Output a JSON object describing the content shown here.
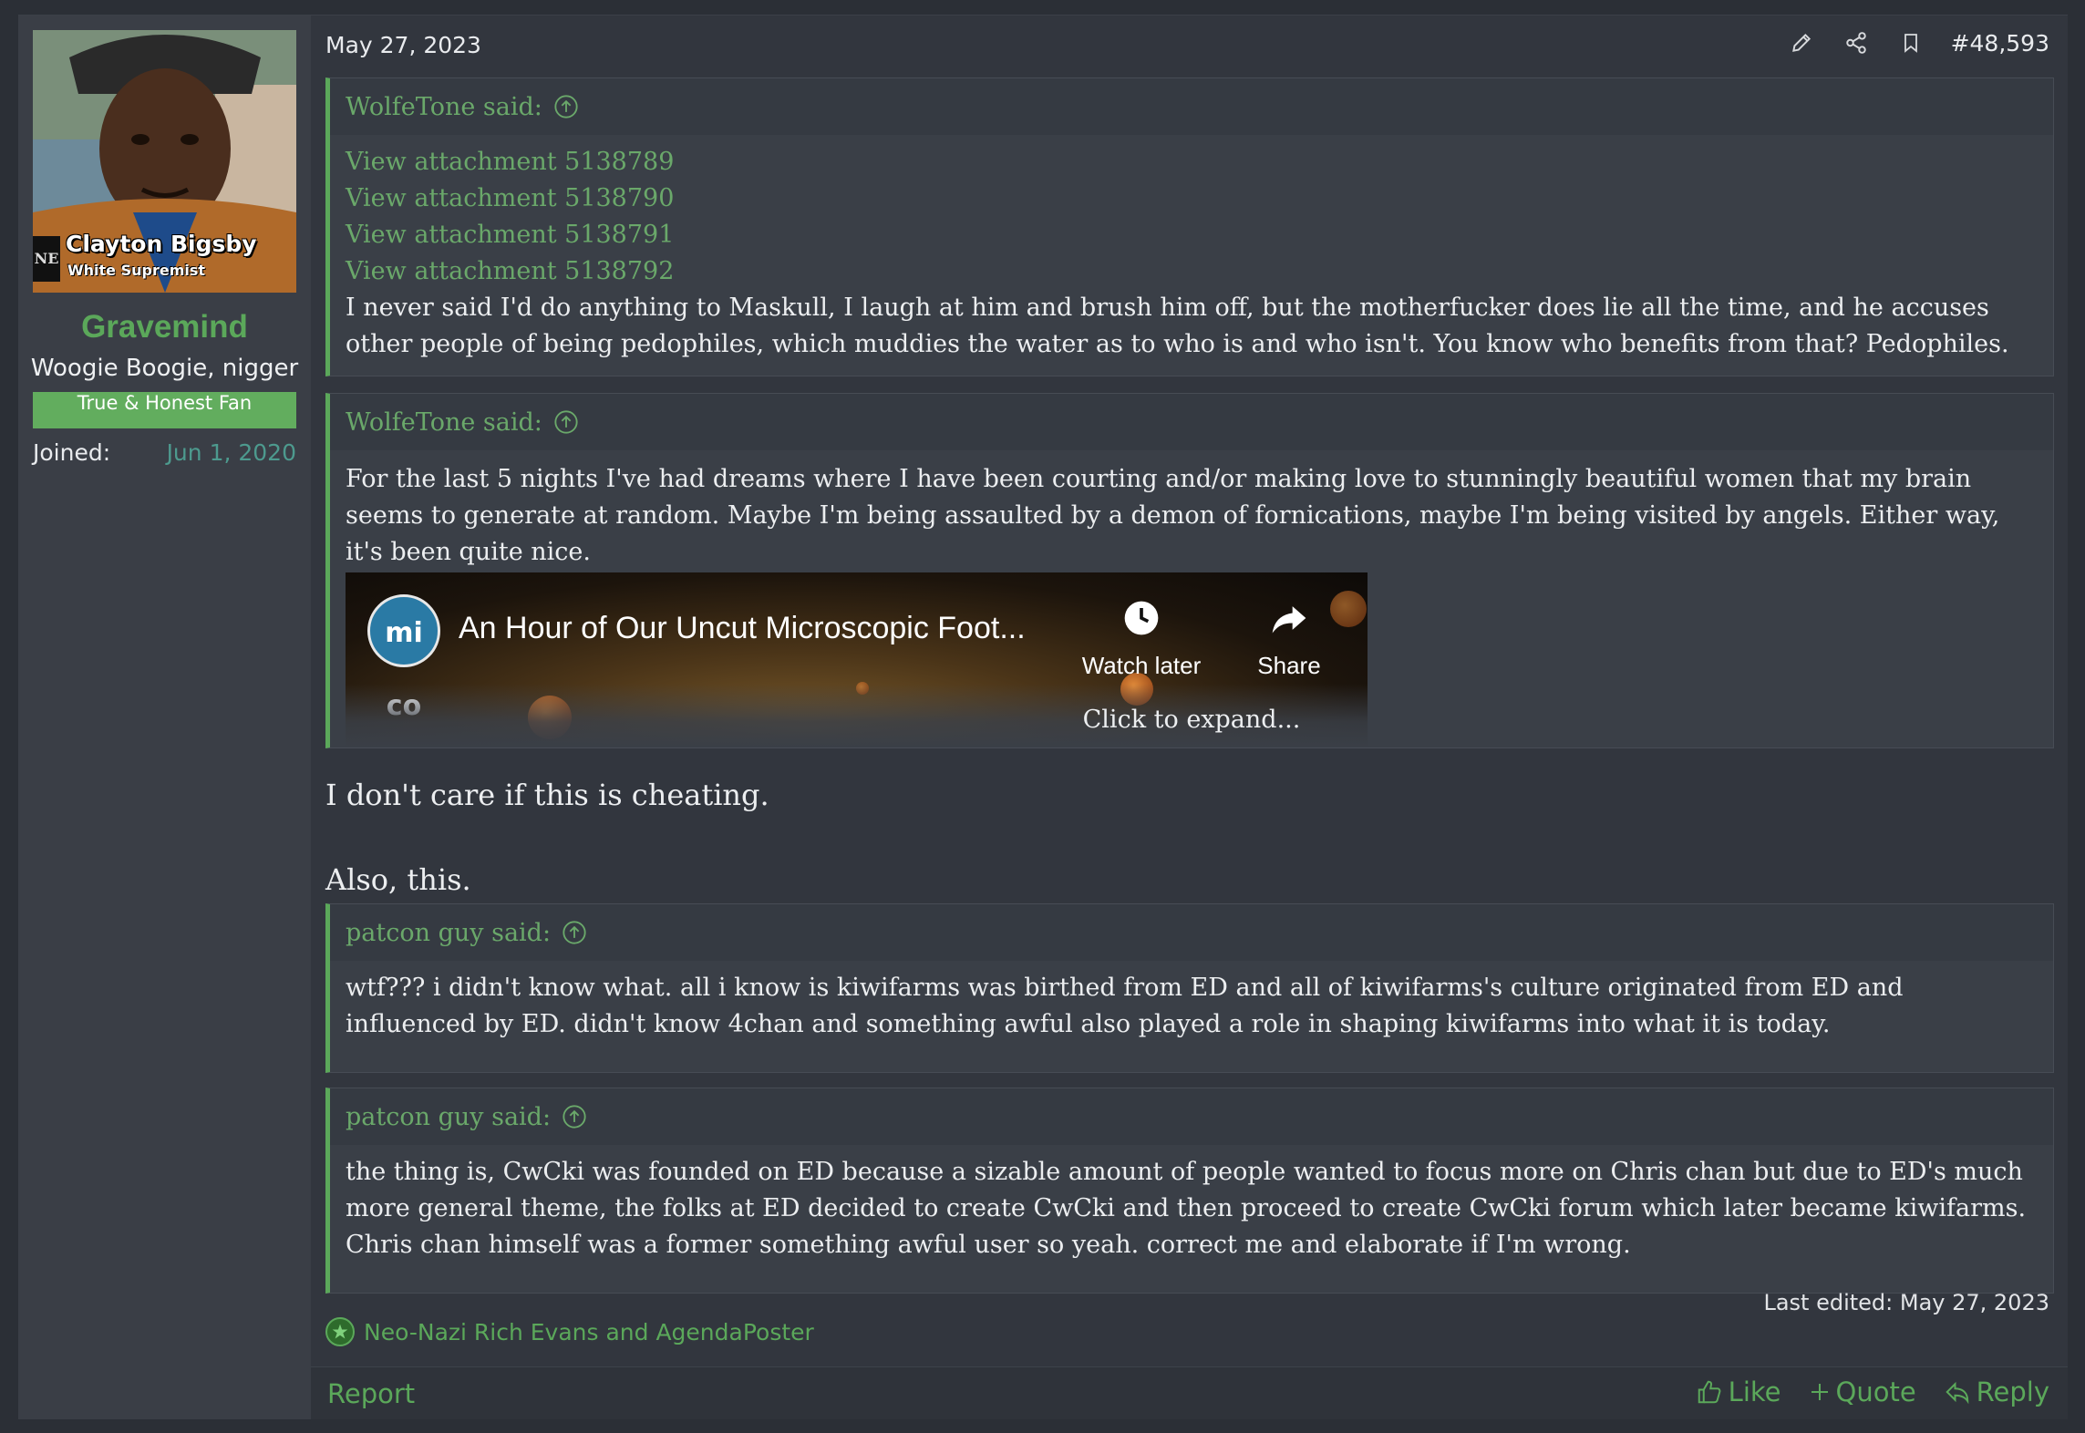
{
  "user": {
    "avatar_caption_name": "Clayton Bigsby",
    "avatar_caption_title": "White Supremist",
    "avatar_logo": "NE",
    "username": "Gravemind",
    "title": "Woogie Boogie, nigger",
    "banner": "True & Honest Fan",
    "joined_label": "Joined:",
    "joined_date": "Jun 1, 2020"
  },
  "post": {
    "date": "May 27, 2023",
    "number": "#48,593",
    "header_icons": [
      "pencil-icon",
      "share-icon",
      "bookmark-icon"
    ]
  },
  "quotes": [
    {
      "author": "WolfeTone said:",
      "attachments": [
        "View attachment 5138789",
        "View attachment 5138790",
        "View attachment 5138791",
        "View attachment 5138792"
      ],
      "text": "I never said I'd do anything to Maskull, I laugh at him and brush him off, but the motherfucker does lie all the time, and he accuses other people of being pedophiles, which muddies the water as to who is and who isn't. You know who benefits from that? Pedophiles."
    },
    {
      "author": "WolfeTone said:",
      "text": "For the last 5 nights I've had dreams where I have been courting and/or making love to stunningly beautiful women that my brain seems to generate at random. Maybe I'm being assaulted by a demon of fornications, maybe I'm being visited by angels. Either way, it's been quite nice.",
      "video": {
        "channel_logo": "mi co",
        "title": "An Hour of Our Uncut Microscopic Foot...",
        "watch_later": "Watch later",
        "share": "Share"
      },
      "expand": "Click to expand..."
    },
    {
      "author": "patcon guy said:",
      "text": "wtf??? i didn't know what. all i know is kiwifarms was birthed from ED and all of kiwifarms's culture originated from ED and influenced by ED. didn't know 4chan and something awful also played a role in shaping kiwifarms into what it is today."
    },
    {
      "author": "patcon guy said:",
      "text": "the thing is, CwCki was founded on ED because a sizable amount of people wanted to focus more on Chris chan but due to ED's much more general theme, the folks at ED decided to create CwCki and then proceed to create CwCki forum which later became kiwifarms. Chris chan himself was a former something awful user so yeah. correct me and elaborate if I'm wrong."
    }
  ],
  "body": {
    "line1": "I don't care if this is cheating.",
    "line2": "Also, this."
  },
  "last_edited": "Last edited: May 27, 2023",
  "reactions": {
    "text": "Neo-Nazi Rich Evans and AgendaPoster"
  },
  "footer": {
    "report": "Report",
    "like": "Like",
    "quote": "Quote",
    "reply": "Reply"
  },
  "colors": {
    "accent": "#5ba85a",
    "background": "#32363e",
    "quote_bg": "#3a3f47"
  }
}
